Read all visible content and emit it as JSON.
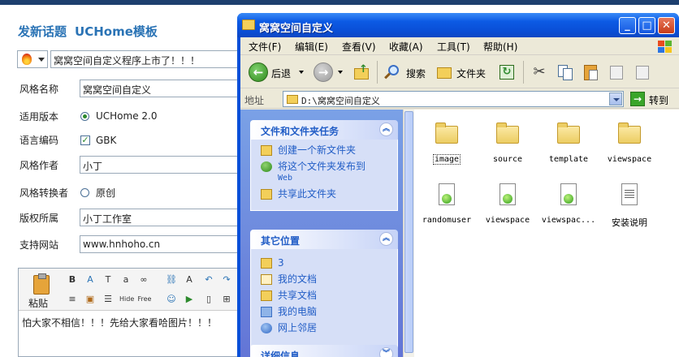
{
  "background_page": {
    "title": "发新话题",
    "subtitle": "UCHome模板",
    "subject_value": "窝窝空间自定义程序上市了！！！",
    "fields": [
      {
        "label": "风格名称",
        "type": "text",
        "value": "窝窝空间自定义"
      },
      {
        "label": "适用版本",
        "type": "radio",
        "value": "UCHome 2.0",
        "checked": true
      },
      {
        "label": "语言编码",
        "type": "checkbox",
        "value": "GBK",
        "checked": true
      },
      {
        "label": "风格作者",
        "type": "text",
        "value": "小丁"
      },
      {
        "label": "风格转换者",
        "type": "radio",
        "value": "原创",
        "checked": false
      },
      {
        "label": "版权所属",
        "type": "text",
        "value": "小丁工作室"
      },
      {
        "label": "支持网站",
        "type": "text",
        "value": "www.hnhoho.cn"
      }
    ],
    "editor": {
      "paste_label": "粘贴",
      "toolbar_icons": [
        "bold-icon",
        "font-color-icon",
        "font-size-icon",
        "link-icon",
        "unlink-icon",
        "clear-format-icon",
        "undo-icon",
        "redo-icon",
        "align-left-icon",
        "list-icon",
        "ordered-list-icon",
        "hide-icon",
        "free-icon",
        "emoticon-icon",
        "media-icon",
        "page-icon",
        "code-icon"
      ],
      "hide_label": "Hide",
      "free_label": "Free",
      "content": "怕大家不相信！！！先给大家看哈图片！！！"
    }
  },
  "window": {
    "title": "窝窝空间自定义",
    "menu": [
      "文件(F)",
      "编辑(E)",
      "查看(V)",
      "收藏(A)",
      "工具(T)",
      "帮助(H)"
    ],
    "toolbar": {
      "back_label": "后退",
      "search_label": "搜索",
      "folders_label": "文件夹"
    },
    "address": {
      "label": "地址",
      "value": "D:\\窝窝空间自定义",
      "go_label": "转到"
    },
    "task_panels": [
      {
        "title": "文件和文件夹任务",
        "tasks": [
          {
            "label": "创建一个新文件夹",
            "icon": "new-folder-icon"
          },
          {
            "label": "将这个文件夹发布到",
            "label2": "Web",
            "icon": "publish-web-icon"
          },
          {
            "label": "共享此文件夹",
            "icon": "share-folder-icon"
          }
        ]
      },
      {
        "title": "其它位置",
        "tasks": [
          {
            "label": "3",
            "icon": "folder-icon"
          },
          {
            "label": "我的文档",
            "icon": "my-documents-icon"
          },
          {
            "label": "共享文档",
            "icon": "shared-documents-icon"
          },
          {
            "label": "我的电脑",
            "icon": "my-computer-icon"
          },
          {
            "label": "网上邻居",
            "icon": "network-places-icon"
          }
        ]
      },
      {
        "title": "详细信息",
        "tasks": []
      }
    ],
    "files": [
      {
        "name": "image",
        "kind": "folder",
        "selected": true
      },
      {
        "name": "source",
        "kind": "folder"
      },
      {
        "name": "template",
        "kind": "folder"
      },
      {
        "name": "viewspace",
        "kind": "folder"
      },
      {
        "name": "randomuser",
        "kind": "dreamweaver"
      },
      {
        "name": "viewspace",
        "kind": "dreamweaver"
      },
      {
        "name": "viewspac...",
        "kind": "dreamweaver"
      },
      {
        "name": "安装说明",
        "kind": "text"
      }
    ],
    "colors": {
      "titlebar": "#0a4ed6",
      "taskpane": "#6f8ee0",
      "task_link": "#215dc6"
    }
  }
}
